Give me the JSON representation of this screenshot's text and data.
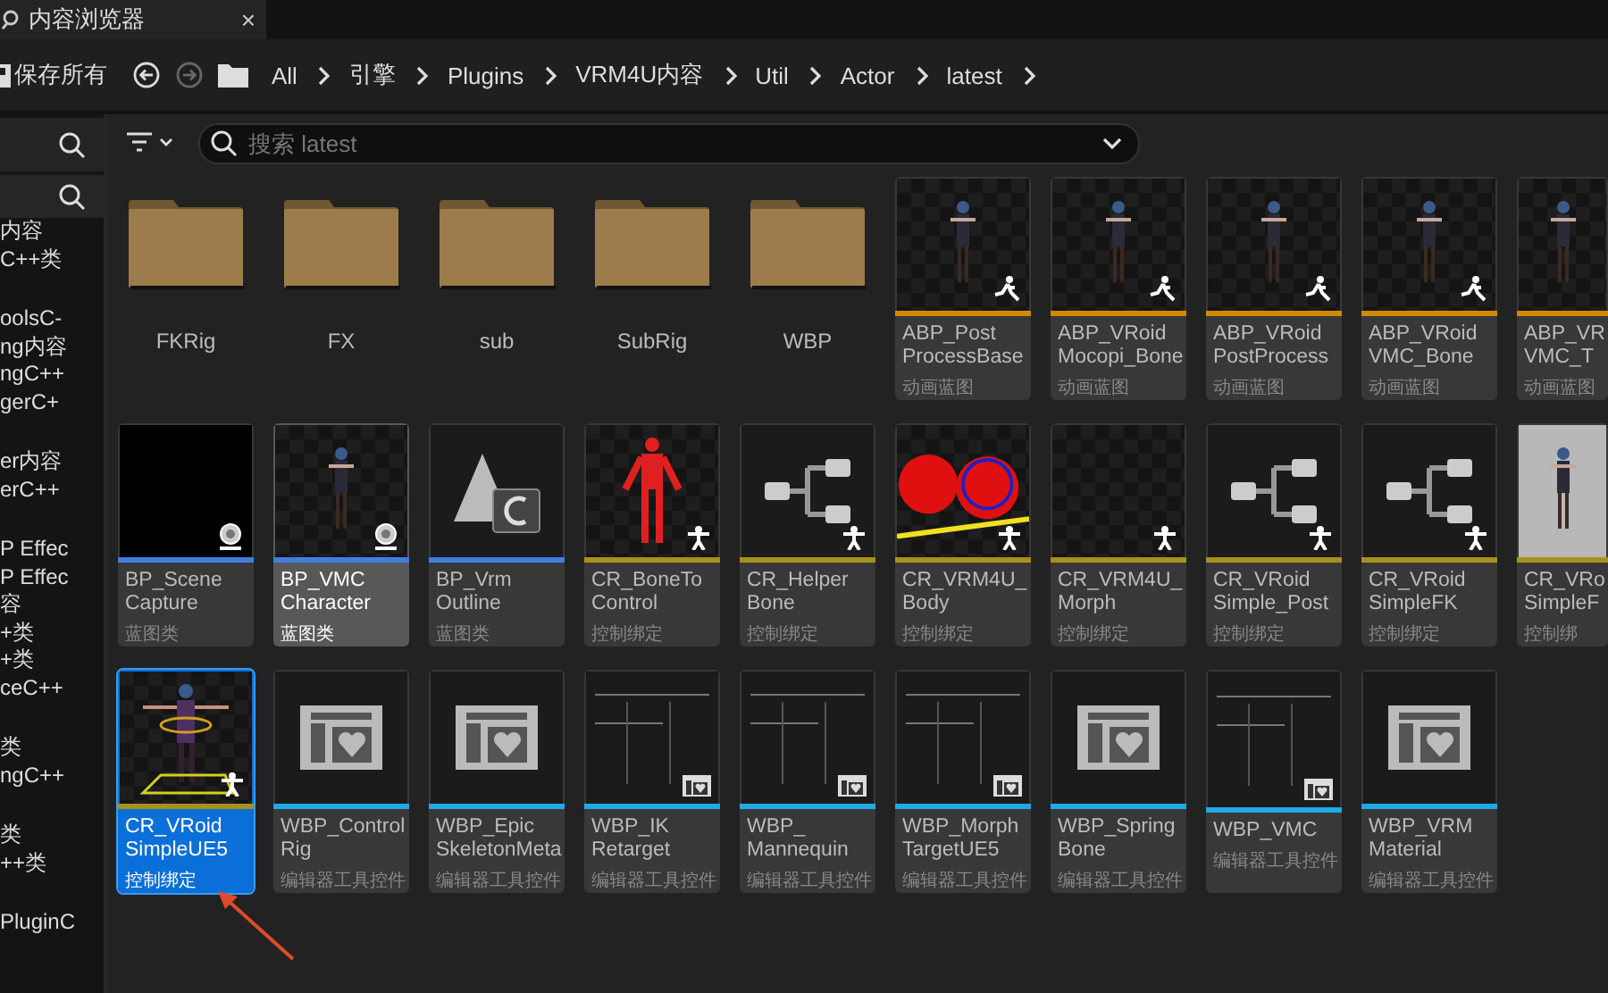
{
  "tab": {
    "title": "内容浏览器",
    "close": "×"
  },
  "toolbar": {
    "save_all": "保存所有",
    "back_enabled": true,
    "forward_enabled": false,
    "breadcrumbs": [
      "All",
      "引擎",
      "Plugins",
      "VRM4U内容",
      "Util",
      "Actor",
      "latest"
    ]
  },
  "sidebar": {
    "groups": [
      [
        "内容",
        "C++类"
      ],
      [
        "oolsC-",
        "ng内容",
        "ngC++",
        "gerC+"
      ],
      [
        "er内容",
        "erC++"
      ],
      [
        "P Effec",
        "P Effec",
        "容",
        "+类",
        "+类",
        "ceC++"
      ],
      [
        "类",
        "ngC++"
      ],
      [
        "类",
        "++类"
      ],
      [
        "PluginC"
      ]
    ]
  },
  "filter_bar": {
    "search": {
      "placeholder": "搜索 latest"
    }
  },
  "assets": [
    {
      "kind": "folder",
      "name_lines": [
        "FKRig"
      ],
      "selected": false,
      "hovered": false
    },
    {
      "kind": "folder",
      "name_lines": [
        "FX"
      ],
      "selected": false,
      "hovered": false
    },
    {
      "kind": "folder",
      "name_lines": [
        "sub"
      ],
      "selected": false,
      "hovered": false
    },
    {
      "kind": "folder",
      "name_lines": [
        "SubRig"
      ],
      "selected": false,
      "hovered": false
    },
    {
      "kind": "folder",
      "name_lines": [
        "WBP"
      ],
      "selected": false,
      "hovered": false
    },
    {
      "kind": "asset",
      "thumb": {
        "kind": "character"
      },
      "badge": {
        "kind": "anim"
      },
      "color": "#d08a00",
      "name_lines": [
        "ABP_Post",
        "ProcessBase"
      ],
      "type": "动画蓝图",
      "selected": false,
      "hovered": false
    },
    {
      "kind": "asset",
      "thumb": {
        "kind": "character"
      },
      "badge": {
        "kind": "anim"
      },
      "color": "#d08a00",
      "name_lines": [
        "ABP_VRoid",
        "Mocopi_Bone"
      ],
      "type": "动画蓝图",
      "selected": false,
      "hovered": false
    },
    {
      "kind": "asset",
      "thumb": {
        "kind": "character"
      },
      "badge": {
        "kind": "anim"
      },
      "color": "#d08a00",
      "name_lines": [
        "ABP_VRoid",
        "PostProcess"
      ],
      "type": "动画蓝图",
      "selected": false,
      "hovered": false
    },
    {
      "kind": "asset",
      "thumb": {
        "kind": "character"
      },
      "badge": {
        "kind": "anim"
      },
      "color": "#d08a00",
      "name_lines": [
        "ABP_VRoid",
        "VMC_Bone"
      ],
      "type": "动画蓝图",
      "selected": false,
      "hovered": false
    },
    {
      "kind": "asset",
      "thumb": {
        "kind": "character"
      },
      "color": "#d08a00",
      "name_lines": [
        "ABP_VR",
        "VMC_T"
      ],
      "type": "动画蓝图",
      "selected": false,
      "hovered": false
    },
    {
      "kind": "asset",
      "thumb": {
        "kind": "black"
      },
      "badge": {
        "kind": "camera"
      },
      "color": "#3d7fe0",
      "name_lines": [
        "BP_Scene",
        "Capture"
      ],
      "type": "蓝图类",
      "selected": false,
      "hovered": false
    },
    {
      "kind": "asset",
      "thumb": {
        "kind": "character"
      },
      "badge": {
        "kind": "camera"
      },
      "color": "#3d7fe0",
      "name_lines": [
        "BP_VMC",
        "Character"
      ],
      "type": "蓝图类",
      "selected": false,
      "hovered": true
    },
    {
      "kind": "asset",
      "thumb": {
        "kind": "class"
      },
      "color": "#3d7fe0",
      "name_lines": [
        "BP_Vrm",
        "Outline"
      ],
      "type": "蓝图类",
      "selected": false,
      "hovered": false
    },
    {
      "kind": "asset",
      "thumb": {
        "kind": "skeleton"
      },
      "badge": {
        "kind": "rig"
      },
      "color": "#a8901c",
      "name_lines": [
        "CR_BoneTo",
        "Control"
      ],
      "type": "控制绑定",
      "selected": false,
      "hovered": false
    },
    {
      "kind": "asset",
      "thumb": {
        "kind": "graph"
      },
      "badge": {
        "kind": "rig"
      },
      "color": "#a8901c",
      "name_lines": [
        "CR_Helper",
        "Bone"
      ],
      "type": "控制绑定",
      "selected": false,
      "hovered": false
    },
    {
      "kind": "asset",
      "thumb": {
        "kind": "blobs"
      },
      "badge": {
        "kind": "rig"
      },
      "color": "#a8901c",
      "name_lines": [
        "CR_VRM4U_",
        "Body"
      ],
      "type": "控制绑定",
      "selected": false,
      "hovered": false
    },
    {
      "kind": "asset",
      "thumb": {
        "kind": "checker"
      },
      "badge": {
        "kind": "rig"
      },
      "color": "#a8901c",
      "name_lines": [
        "CR_VRM4U_",
        "Morph"
      ],
      "type": "控制绑定",
      "selected": false,
      "hovered": false
    },
    {
      "kind": "asset",
      "thumb": {
        "kind": "graph"
      },
      "badge": {
        "kind": "rig"
      },
      "color": "#a8901c",
      "name_lines": [
        "CR_VRoid",
        "Simple_Post"
      ],
      "type": "控制绑定",
      "selected": false,
      "hovered": false
    },
    {
      "kind": "asset",
      "thumb": {
        "kind": "graph"
      },
      "badge": {
        "kind": "rig"
      },
      "color": "#a8901c",
      "name_lines": [
        "CR_VRoid",
        "SimpleFK"
      ],
      "type": "控制绑定",
      "selected": false,
      "hovered": false
    },
    {
      "kind": "asset",
      "thumb": {
        "kind": "photo"
      },
      "color": "#a8901c",
      "name_lines": [
        "CR_VRo",
        "SimpleF"
      ],
      "type": "控制绑",
      "selected": false,
      "hovered": false
    },
    {
      "kind": "asset",
      "thumb": {
        "kind": "rigged"
      },
      "badge": {
        "kind": "rig"
      },
      "color": "#a8901c",
      "name_lines": [
        "CR_VRoid",
        "SimpleUE5"
      ],
      "type": "控制绑定",
      "selected": true,
      "hovered": false
    },
    {
      "kind": "asset",
      "thumb": {
        "kind": "widget"
      },
      "color": "#1fa9e8",
      "name_lines": [
        "WBP_Control",
        "Rig"
      ],
      "type": "编辑器工具控件",
      "selected": false,
      "hovered": false
    },
    {
      "kind": "asset",
      "thumb": {
        "kind": "widget"
      },
      "color": "#1fa9e8",
      "name_lines": [
        "WBP_Epic",
        "SkeletonMeta"
      ],
      "type": "编辑器工具控件",
      "selected": false,
      "hovered": false
    },
    {
      "kind": "asset",
      "thumb": {
        "kind": "panel"
      },
      "badge": {
        "kind": "widget"
      },
      "color": "#1fa9e8",
      "name_lines": [
        "WBP_IK",
        "Retarget"
      ],
      "type": "编辑器工具控件",
      "selected": false,
      "hovered": false
    },
    {
      "kind": "asset",
      "thumb": {
        "kind": "panel"
      },
      "badge": {
        "kind": "widget"
      },
      "color": "#1fa9e8",
      "name_lines": [
        "WBP_",
        "Mannequin"
      ],
      "type": "编辑器工具控件",
      "selected": false,
      "hovered": false
    },
    {
      "kind": "asset",
      "thumb": {
        "kind": "panel"
      },
      "badge": {
        "kind": "widget"
      },
      "color": "#1fa9e8",
      "name_lines": [
        "WBP_Morph",
        "TargetUE5"
      ],
      "type": "编辑器工具控件",
      "selected": false,
      "hovered": false
    },
    {
      "kind": "asset",
      "thumb": {
        "kind": "widget"
      },
      "color": "#1fa9e8",
      "name_lines": [
        "WBP_Spring",
        "Bone"
      ],
      "type": "编辑器工具控件",
      "selected": false,
      "hovered": false
    },
    {
      "kind": "asset",
      "thumb": {
        "kind": "panel"
      },
      "badge": {
        "kind": "widget"
      },
      "color": "#1fa9e8",
      "name_lines": [
        "WBP_VMC"
      ],
      "type": "编辑器工具控件",
      "selected": false,
      "hovered": false
    },
    {
      "kind": "asset",
      "thumb": {
        "kind": "widget"
      },
      "color": "#1fa9e8",
      "name_lines": [
        "WBP_VRM",
        "Material"
      ],
      "type": "编辑器工具控件",
      "selected": false,
      "hovered": false
    }
  ]
}
